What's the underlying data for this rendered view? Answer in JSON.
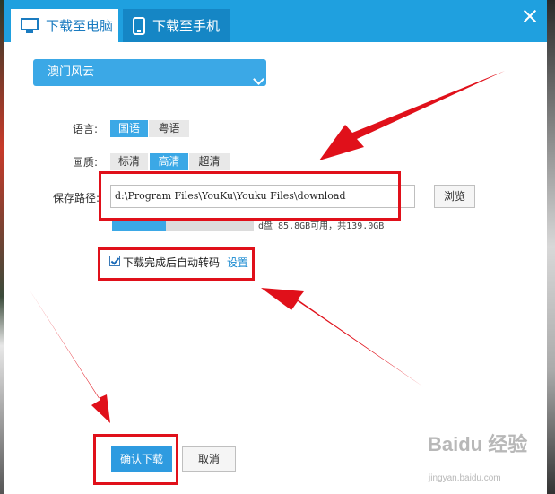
{
  "tabs": [
    {
      "label": "下载至电脑",
      "active": true,
      "icon": "monitor-icon"
    },
    {
      "label": "下载至手机",
      "active": false,
      "icon": "phone-icon"
    }
  ],
  "video_select": {
    "value": "澳门风云"
  },
  "language": {
    "label": "语言:",
    "options": [
      "国语",
      "粤语"
    ],
    "selected": "国语"
  },
  "quality": {
    "label": "画质:",
    "options": [
      "标清",
      "高清",
      "超清"
    ],
    "selected": "高清"
  },
  "save_path": {
    "label": "保存路径:",
    "value": "d:\\Program Files\\YouKu\\Youku Files\\download",
    "browse_label": "浏览"
  },
  "disk": {
    "text": "d盘 85.8GB可用，共139.0GB",
    "used_fraction": 0.38
  },
  "auto_transcode": {
    "checked": true,
    "label": "下载完成后自动转码",
    "settings_label": "设置"
  },
  "buttons": {
    "confirm": "确认下载",
    "cancel": "取消"
  },
  "watermark": {
    "text": "Baidu 经验",
    "sub": "jingyan.baidu.com"
  },
  "colors": {
    "accent": "#1fa0df",
    "annotation": "#e0101a"
  }
}
